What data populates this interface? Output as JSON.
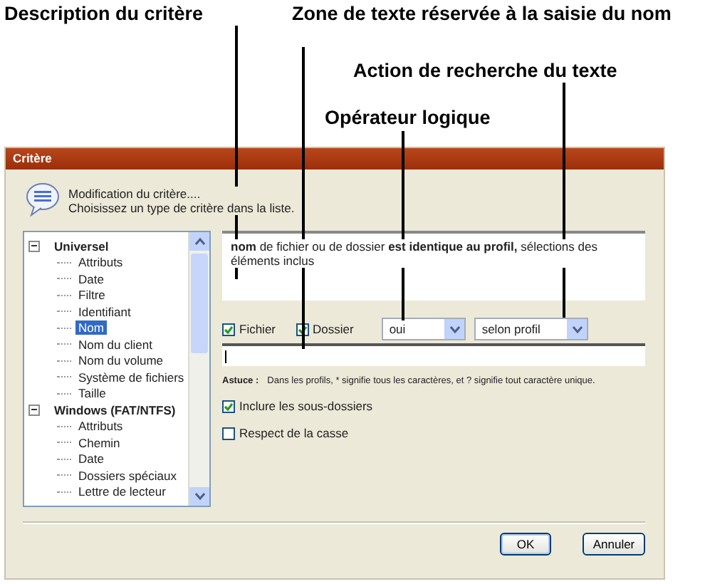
{
  "annotations": [
    {
      "text": "Description du critère"
    },
    {
      "text": "Zone de texte réservée à la saisie du nom"
    },
    {
      "text": "Action de recherche du texte"
    },
    {
      "text": "Opérateur logique"
    }
  ],
  "dialog": {
    "title": "Critère",
    "header": {
      "title": "Modification du critère....",
      "subtitle": "Choisissez un type de critère dans la liste."
    },
    "tree": [
      {
        "label": "Universel",
        "expanded": true,
        "selected": false,
        "children": [
          {
            "label": "Attributs",
            "selected": false
          },
          {
            "label": "Date",
            "selected": false
          },
          {
            "label": "Filtre",
            "selected": false
          },
          {
            "label": "Identifiant",
            "selected": false
          },
          {
            "label": "Nom",
            "selected": true
          },
          {
            "label": "Nom du client",
            "selected": false
          },
          {
            "label": "Nom du volume",
            "selected": false
          },
          {
            "label": "Système de fichiers",
            "selected": false
          },
          {
            "label": "Taille",
            "selected": false
          }
        ]
      },
      {
        "label": "Windows (FAT/NTFS)",
        "expanded": true,
        "selected": false,
        "children": [
          {
            "label": "Attributs",
            "selected": false
          },
          {
            "label": "Chemin",
            "selected": false
          },
          {
            "label": "Date",
            "selected": false
          },
          {
            "label": "Dossiers spéciaux",
            "selected": false
          },
          {
            "label": "Lettre de lecteur",
            "selected": false
          }
        ]
      }
    ],
    "description": "**nom** de fichier ou de dossier **est identique au profil,** sélections des éléments inclus",
    "type_checkboxes": [
      {
        "label": "Fichier",
        "checked": true
      },
      {
        "label": "Dossier",
        "checked": true
      }
    ],
    "operator": {
      "value": "oui"
    },
    "search_action": {
      "value": "selon profil"
    },
    "tip": {
      "label": "Astuce :",
      "text": "Dans les profils, * signifie tous les caractères, et ? signifie tout caractère unique."
    },
    "options": [
      {
        "label": "Inclure les sous-dossiers",
        "checked": true
      },
      {
        "label": "Respect de la casse",
        "checked": false
      }
    ],
    "buttons": [
      {
        "label": "OK",
        "kind": "default"
      },
      {
        "label": "Annuler",
        "kind": "normal"
      }
    ]
  }
}
